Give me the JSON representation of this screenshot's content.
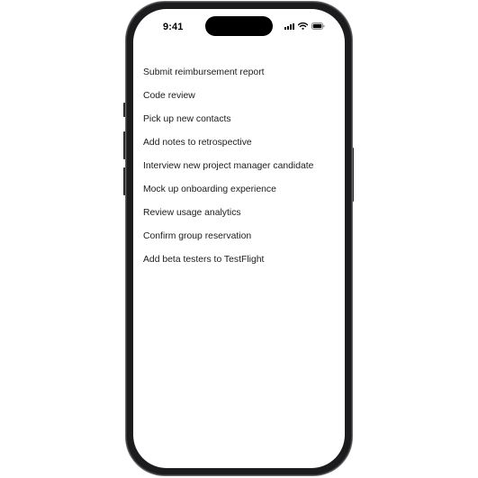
{
  "status_bar": {
    "time": "9:41",
    "icons": [
      "signal-icon",
      "wifi-icon",
      "battery-icon"
    ]
  },
  "todos": [
    "Submit reimbursement report",
    "Code review",
    "Pick up new contacts",
    "Add notes to retrospective",
    "Interview new project manager candidate",
    "Mock up onboarding experience",
    "Review usage analytics",
    "Confirm group reservation",
    "Add beta testers to TestFlight"
  ]
}
